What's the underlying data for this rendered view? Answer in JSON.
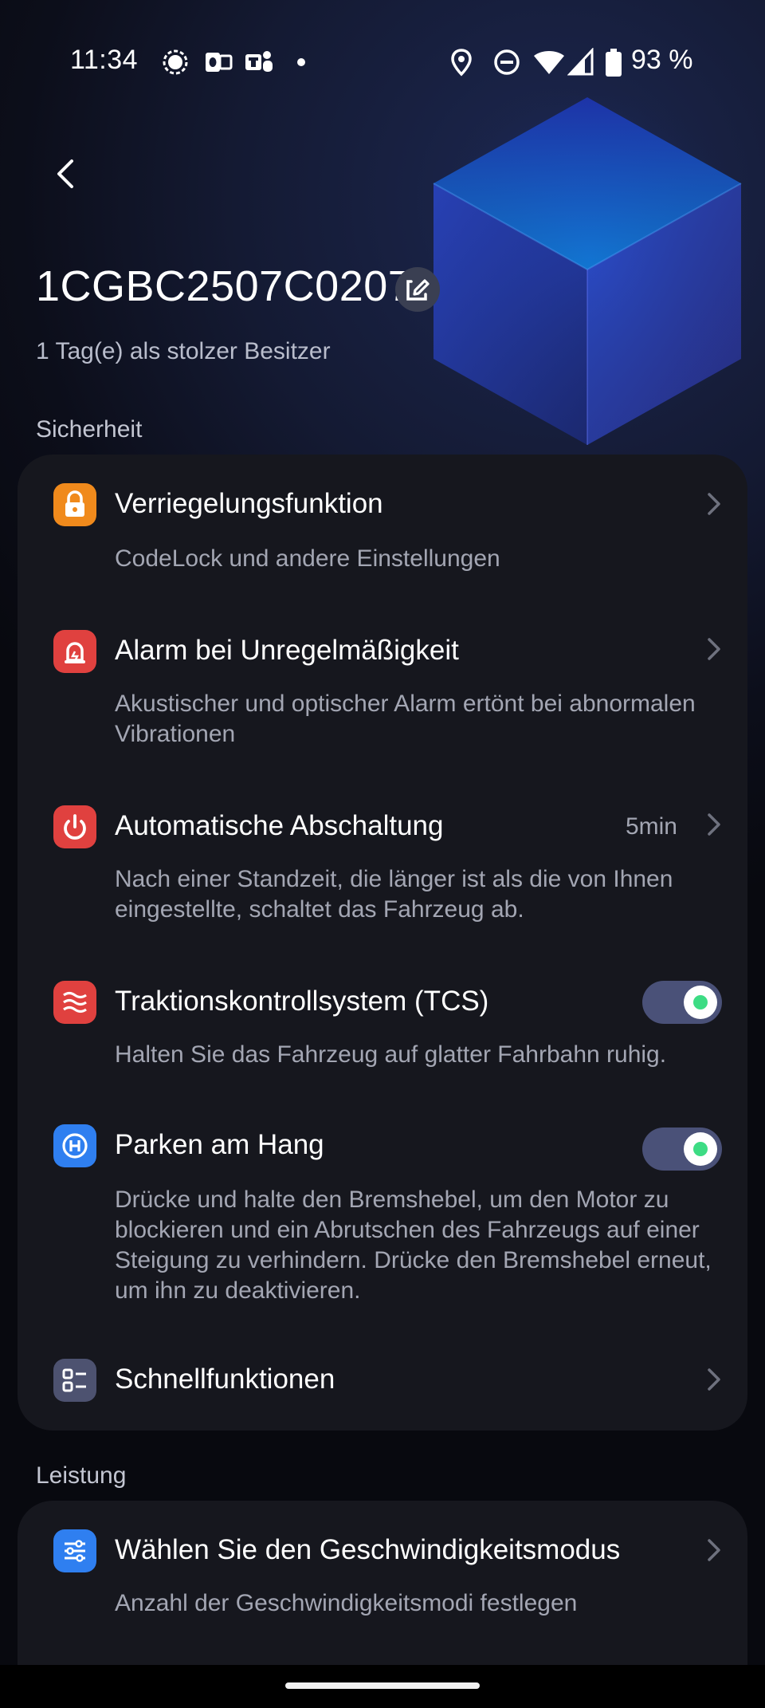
{
  "status_bar": {
    "time": "11:34",
    "battery_percent": "93 %"
  },
  "header": {
    "title": "1CGBC2507C0207",
    "subtitle": "1 Tag(e) als stolzer Besitzer"
  },
  "sections": {
    "safety": {
      "label": "Sicherheit",
      "items": [
        {
          "label": "Verriegelungsfunktion",
          "desc": "CodeLock und andere Einstellungen",
          "icon": "lock-icon",
          "color": "#f08a1c"
        },
        {
          "label": "Alarm bei Unregelmäßigkeit",
          "desc": "Akustischer und optischer Alarm ertönt bei abnormalen Vibrationen",
          "icon": "alarm-icon",
          "color": "#e0413f"
        },
        {
          "label": "Automatische Abschaltung",
          "value": "5min",
          "desc": "Nach einer Standzeit, die länger ist als die von Ihnen eingestellte, schaltet das Fahrzeug ab.",
          "icon": "power-icon",
          "color": "#e0413f"
        },
        {
          "label": "Traktionskontrollsystem (TCS)",
          "desc": "Halten Sie das Fahrzeug auf glatter Fahrbahn ruhig.",
          "icon": "traction-icon",
          "color": "#e0413f",
          "toggle": true
        },
        {
          "label": "Parken am Hang",
          "desc": "Drücke und halte den Bremshebel, um den Motor zu blockieren und ein Abrutschen des Fahrzeugs auf einer Steigung zu verhindern. Drücke den Bremshebel erneut, um ihn zu deaktivieren.",
          "icon": "hill-hold-icon",
          "color": "#2f7ff0",
          "toggle": true
        },
        {
          "label": "Schnellfunktionen",
          "icon": "quick-functions-icon",
          "color": "#4d5270"
        }
      ]
    },
    "performance": {
      "label": "Leistung",
      "items": [
        {
          "label": "Wählen Sie den Geschwindigkeitsmodus",
          "desc": "Anzahl der Geschwindigkeitsmodi festlegen",
          "icon": "sliders-icon",
          "color": "#2f7ff0"
        }
      ]
    }
  }
}
